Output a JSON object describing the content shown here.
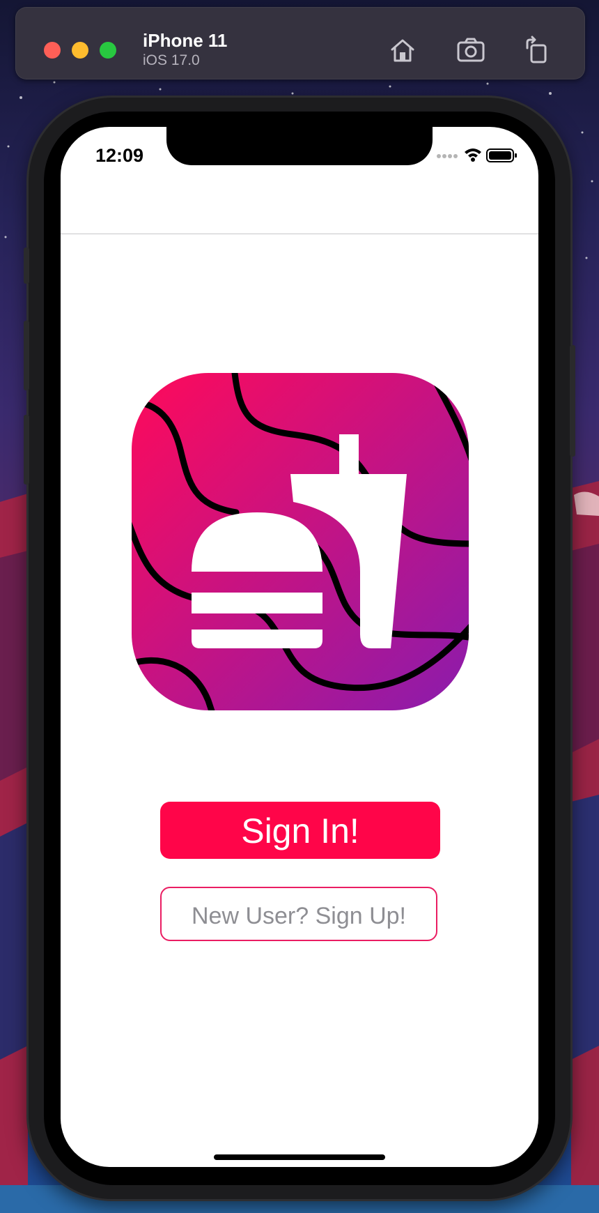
{
  "simulator": {
    "device_name": "iPhone 11",
    "os_version": "iOS 17.0",
    "toolbar_icons": [
      "home-icon",
      "screenshot-icon",
      "rotate-icon"
    ]
  },
  "status_bar": {
    "time": "12:09",
    "icons": [
      "cellular-dots-icon",
      "wifi-icon",
      "battery-icon"
    ]
  },
  "app": {
    "logo_icon": "burger-and-drink-logo",
    "sign_in_label": "Sign In!",
    "sign_up_label": "New User? Sign Up!"
  },
  "colors": {
    "primary_button": "#ff0549",
    "outline_border": "#ea1d62",
    "secondary_text": "#8e8e93",
    "logo_gradient_start": "#ff0a5a",
    "logo_gradient_end": "#8a1cad"
  }
}
